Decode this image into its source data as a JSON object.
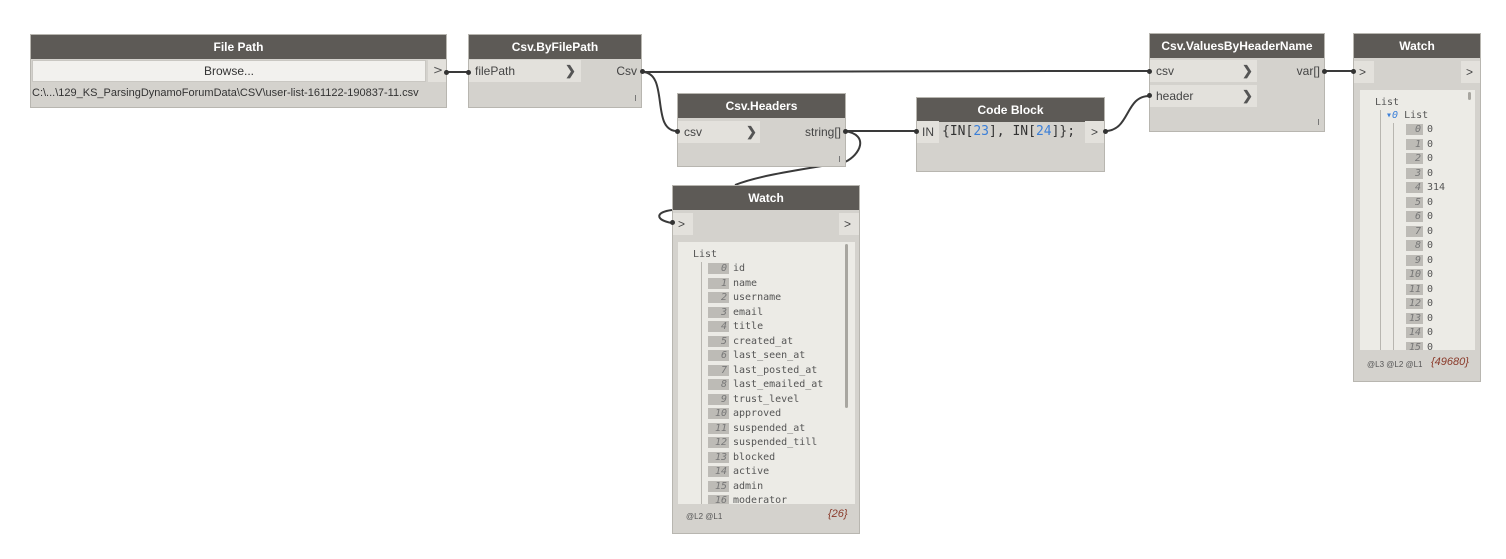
{
  "nodes": {
    "file_path": {
      "title": "File Path",
      "browse_label": "Browse...",
      "output_chevron": ">",
      "path_value": "C:\\...\\129_KS_ParsingDynamoForumData\\CSV\\user-list-161122-190837-11.csv"
    },
    "csv_by_file_path": {
      "title": "Csv.ByFilePath",
      "input_label": "filePath",
      "output_label": "Csv"
    },
    "csv_headers": {
      "title": "Csv.Headers",
      "input_label": "csv",
      "output_label": "string[]"
    },
    "code_block": {
      "title": "Code Block",
      "input_label": "IN",
      "code_open": "{IN[",
      "code_num1": "23",
      "code_mid": "], IN[",
      "code_num2": "24",
      "code_close": "]};",
      "output_chevron": ">"
    },
    "csv_values_by_header": {
      "title": "Csv.ValuesByHeaderName",
      "input1_label": "csv",
      "input2_label": "header",
      "output_label": "var[]"
    },
    "watch_headers": {
      "title": "Watch",
      "in_chevron": ">",
      "out_chevron": ">",
      "root_label": "List",
      "items": [
        {
          "i": "0",
          "v": "id"
        },
        {
          "i": "1",
          "v": "name"
        },
        {
          "i": "2",
          "v": "username"
        },
        {
          "i": "3",
          "v": "email"
        },
        {
          "i": "4",
          "v": "title"
        },
        {
          "i": "5",
          "v": "created_at"
        },
        {
          "i": "6",
          "v": "last_seen_at"
        },
        {
          "i": "7",
          "v": "last_posted_at"
        },
        {
          "i": "8",
          "v": "last_emailed_at"
        },
        {
          "i": "9",
          "v": "trust_level"
        },
        {
          "i": "10",
          "v": "approved"
        },
        {
          "i": "11",
          "v": "suspended_at"
        },
        {
          "i": "12",
          "v": "suspended_till"
        },
        {
          "i": "13",
          "v": "blocked"
        },
        {
          "i": "14",
          "v": "active"
        },
        {
          "i": "15",
          "v": "admin"
        },
        {
          "i": "16",
          "v": "moderator"
        }
      ],
      "levels": "@L2 @L1",
      "count": "{26}"
    },
    "watch_values": {
      "title": "Watch",
      "in_chevron": ">",
      "out_chevron": ">",
      "root_label": "List",
      "sub_label": "List",
      "sub_index": "0",
      "items": [
        {
          "i": "0",
          "v": "0"
        },
        {
          "i": "1",
          "v": "0"
        },
        {
          "i": "2",
          "v": "0"
        },
        {
          "i": "3",
          "v": "0"
        },
        {
          "i": "4",
          "v": "314"
        },
        {
          "i": "5",
          "v": "0"
        },
        {
          "i": "6",
          "v": "0"
        },
        {
          "i": "7",
          "v": "0"
        },
        {
          "i": "8",
          "v": "0"
        },
        {
          "i": "9",
          "v": "0"
        },
        {
          "i": "10",
          "v": "0"
        },
        {
          "i": "11",
          "v": "0"
        },
        {
          "i": "12",
          "v": "0"
        },
        {
          "i": "13",
          "v": "0"
        },
        {
          "i": "14",
          "v": "0"
        },
        {
          "i": "15",
          "v": "0"
        }
      ],
      "levels": "@L3 @L2 @L1",
      "count": "{49680}"
    }
  },
  "colors": {
    "title_bar": "#5d5a56",
    "node_body": "#d4d2cd",
    "wire": "#3a3a3a",
    "code_number": "#3b7fd8",
    "count_text": "#8a3a2a"
  }
}
